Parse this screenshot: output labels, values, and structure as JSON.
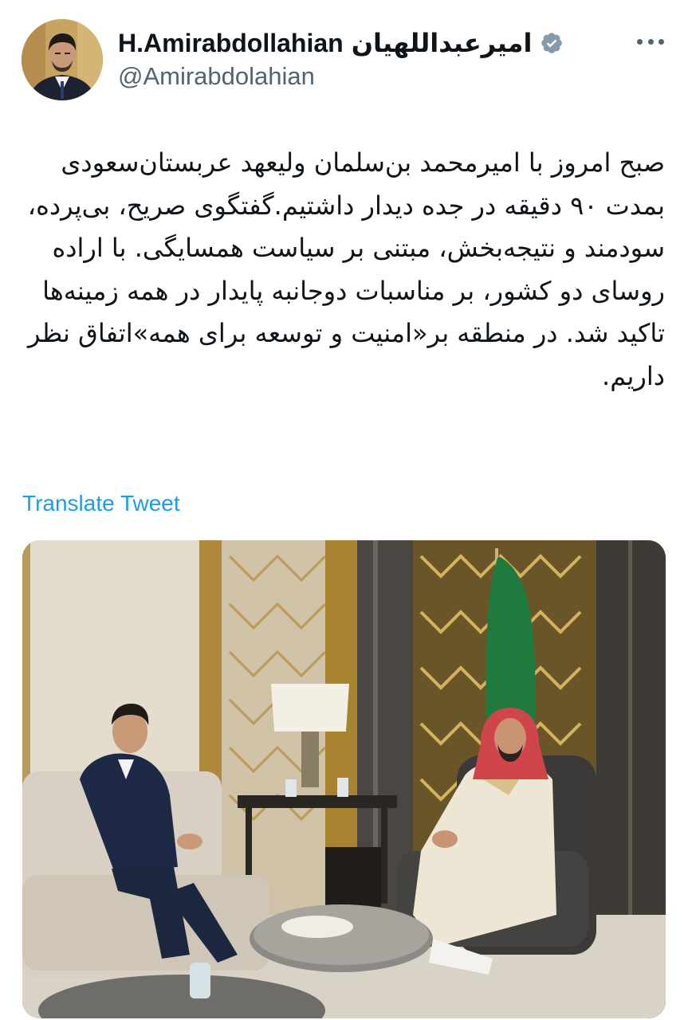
{
  "tweet": {
    "author": {
      "display_name_latin": "H.Amirabdollahian",
      "display_name_persian": "امیرعبداللهیان",
      "handle": "@Amirabdolahian",
      "avatar_icon": "profile-photo",
      "verified_icon": "verified-badge-icon",
      "verified_color": "#829aab"
    },
    "more_icon": "more-options-icon",
    "text": "صبح امروز با امیرمحمد بن‌سلمان ولیعهد عربستان‌سعودی بمدت ۹۰ دقیقه در جده دیدار داشتیم.گفتگوی صریح، بی‌پرده، سودمند و نتیجه‌بخش، مبتنی بر سیاست همسایگی. با اراده روسای دو کشور، بر مناسبات دوجانبه پایدار در همه زمینه‌ها تاکید شد. در منطقه بر«امنیت و توسعه برای همه»اتفاق نظر داریم.",
    "translate_label": "Translate Tweet",
    "link_color": "#1d9bf0",
    "media": {
      "type": "photo"
    }
  }
}
